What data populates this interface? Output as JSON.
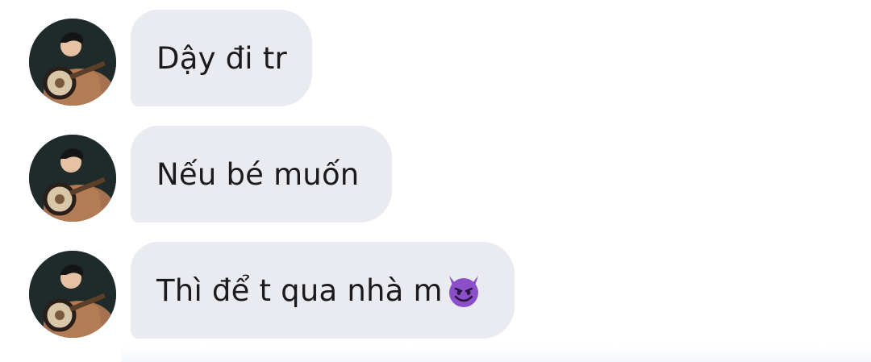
{
  "messages": [
    {
      "text": "Dậy đi tr",
      "avatar_icon": "sender-avatar"
    },
    {
      "text": "Nếu bé muốn",
      "avatar_icon": "sender-avatar"
    },
    {
      "text": "Thì để t qua nhà m",
      "avatar_icon": "sender-avatar",
      "trailing_emoji": "smiling-devil-emoji"
    }
  ],
  "colors": {
    "bubble": "#e9ebf0",
    "text": "#1b1b1e",
    "emoji": "#8b4fc9"
  }
}
